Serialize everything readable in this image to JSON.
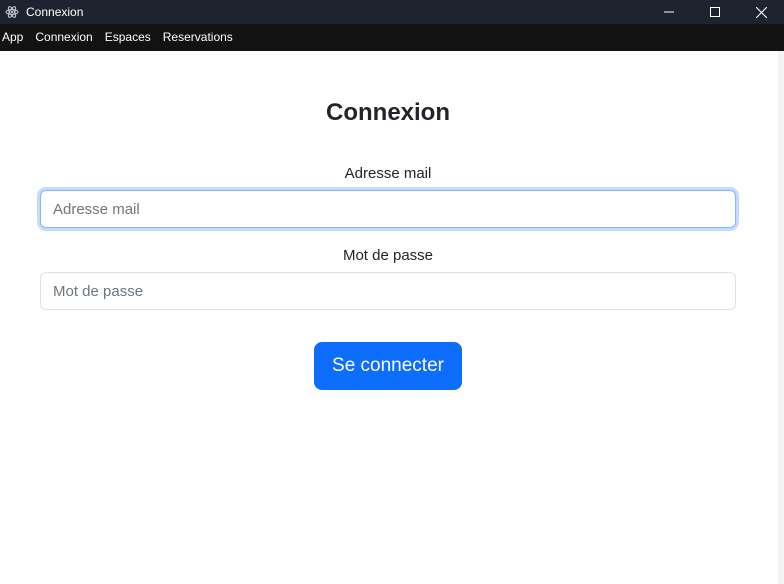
{
  "window": {
    "title": "Connexion",
    "icon": "electron-atom-icon",
    "controls": [
      "minimize-icon",
      "maximize-icon",
      "close-icon"
    ]
  },
  "menu": {
    "items": [
      {
        "label": "App"
      },
      {
        "label": "Connexion"
      },
      {
        "label": "Espaces"
      },
      {
        "label": "Reservations"
      }
    ]
  },
  "form": {
    "heading": "Connexion",
    "email": {
      "label": "Adresse mail",
      "placeholder": "Adresse mail",
      "value": ""
    },
    "password": {
      "label": "Mot de passe",
      "placeholder": "Mot de passe",
      "value": ""
    },
    "submit_label": "Se connecter"
  },
  "colors": {
    "titlebar": "#1f2330",
    "menubar": "#121212",
    "primary": "#0d6efd",
    "focus_border": "#86b7fe"
  }
}
